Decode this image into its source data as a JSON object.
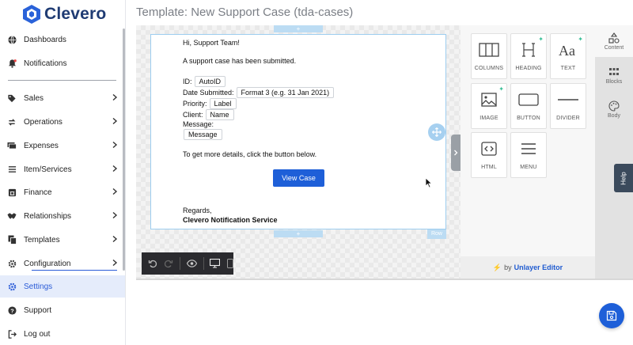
{
  "app": {
    "name": "Clevero"
  },
  "page": {
    "title": "Template: New Support Case (tda-cases)"
  },
  "sidebar": {
    "items": [
      {
        "label": "Dashboards",
        "icon": "globe-icon",
        "has_children": false
      },
      {
        "label": "Notifications",
        "icon": "bell-icon",
        "has_children": false
      },
      {
        "label": "Sales",
        "icon": "tag-icon",
        "has_children": true
      },
      {
        "label": "Operations",
        "icon": "sync-icon",
        "has_children": true
      },
      {
        "label": "Expenses",
        "icon": "money-icon",
        "has_children": true
      },
      {
        "label": "Item/Services",
        "icon": "list-icon",
        "has_children": true
      },
      {
        "label": "Finance",
        "icon": "bank-icon",
        "has_children": true
      },
      {
        "label": "Relationships",
        "icon": "handshake-icon",
        "has_children": true
      },
      {
        "label": "Templates",
        "icon": "copy-icon",
        "has_children": true
      },
      {
        "label": "Configuration",
        "icon": "cog-icon",
        "has_children": true
      },
      {
        "label": "Settings",
        "icon": "gear-icon",
        "has_children": false,
        "active": true
      },
      {
        "label": "Support",
        "icon": "question-icon",
        "has_children": false
      },
      {
        "label": "Log out",
        "icon": "logout-icon",
        "has_children": false
      }
    ]
  },
  "email": {
    "greeting": "Hi, Support Team!",
    "intro": "A support case has been submitted.",
    "fields": [
      {
        "label": "ID:",
        "value": "AutoID"
      },
      {
        "label": "Date Submitted:",
        "value": "Format 3 (e.g. 31 Jan 2021)"
      },
      {
        "label": "Priority:",
        "value": "Label"
      },
      {
        "label": "Client:",
        "value": "Name"
      },
      {
        "label": "Message:",
        "value": "Message"
      }
    ],
    "cta_text": "To get more details, click the button below.",
    "button_label": "View Case",
    "closing": "Regards,",
    "signature": "Clevero Notification Service",
    "row_tag": "Row",
    "add_symbol": "+"
  },
  "tools": [
    {
      "label": "COLUMNS",
      "icon": "columns-icon",
      "new": false
    },
    {
      "label": "HEADING",
      "icon": "heading-icon",
      "new": true
    },
    {
      "label": "TEXT",
      "icon": "text-icon",
      "new": true
    },
    {
      "label": "IMAGE",
      "icon": "image-icon",
      "new": true
    },
    {
      "label": "BUTTON",
      "icon": "button-icon",
      "new": false
    },
    {
      "label": "DIVIDER",
      "icon": "divider-icon",
      "new": false
    },
    {
      "label": "HTML",
      "icon": "html-icon",
      "new": false
    },
    {
      "label": "MENU",
      "icon": "menu-icon",
      "new": false
    }
  ],
  "tools_footer": {
    "prefix": "by",
    "brand": "Unlayer Editor"
  },
  "side_tabs": [
    {
      "label": "Content",
      "icon": "shapes-icon",
      "active": true
    },
    {
      "label": "Blocks",
      "icon": "blocks-icon",
      "active": false
    },
    {
      "label": "Body",
      "icon": "palette-icon",
      "active": false
    }
  ],
  "help": {
    "label": "Help"
  },
  "colors": {
    "accent": "#1e5fd8",
    "brand": "#1f3b73",
    "active_bg": "#e5ecfb",
    "new_badge": "#3bbf97"
  }
}
